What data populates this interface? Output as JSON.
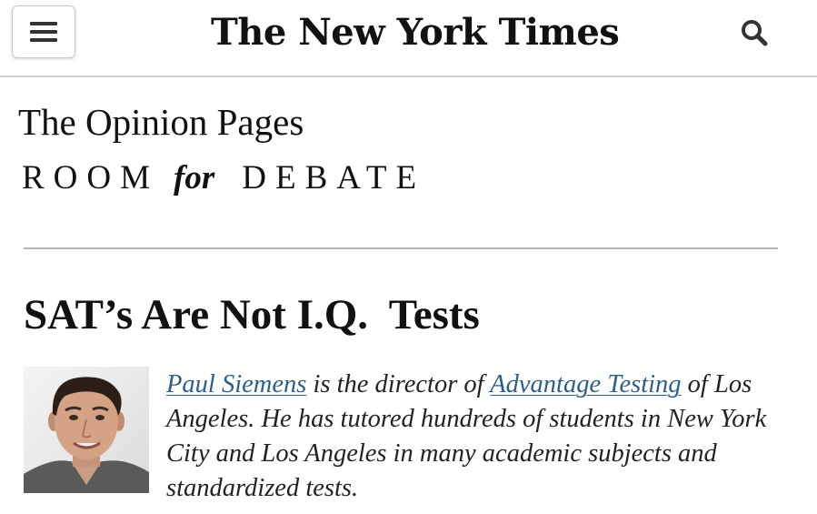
{
  "header": {
    "menu_icon": "hamburger-menu-icon",
    "masthead": "The New York Times",
    "search_icon": "search-icon"
  },
  "section": {
    "title": "The Opinion Pages",
    "series_room": "ROOM",
    "series_for": "for",
    "series_debate": "DEBATE"
  },
  "article": {
    "headline": "SAT’s Are Not I.Q.  Tests"
  },
  "author": {
    "name": "Paul Siemens",
    "text_1": " is the director of ",
    "organization": "Advantage Testing",
    "text_2": " of Los Angeles. He has tutored hundreds of students in New York City and Los Angeles in many academic subjects and standardized tests."
  },
  "colors": {
    "link": "#2c5f8a",
    "divider": "#b4b4b4",
    "text": "#111111"
  }
}
